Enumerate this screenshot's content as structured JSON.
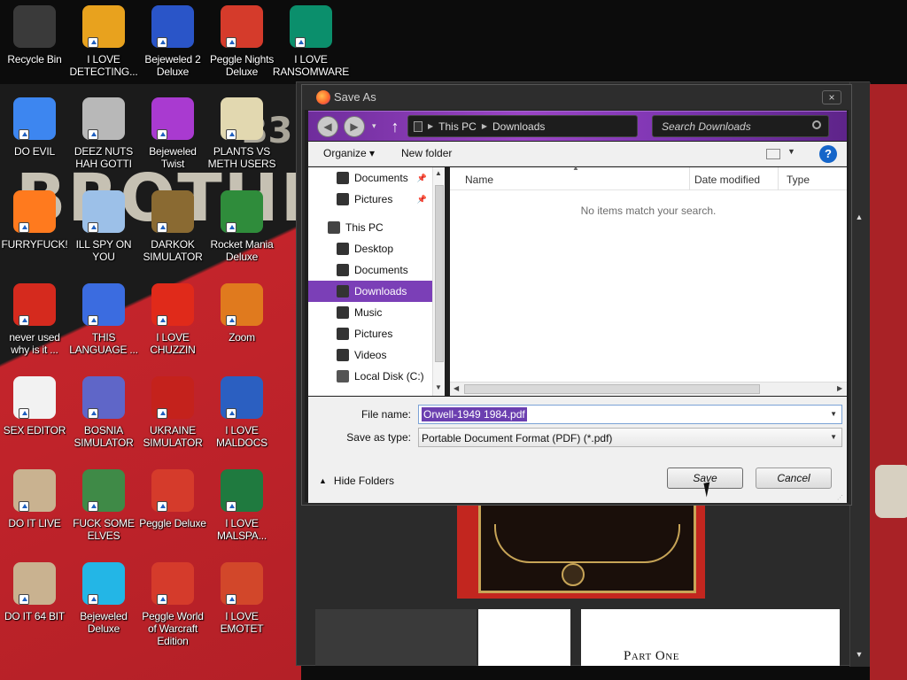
{
  "desktop": {
    "wallpaper_word": "BROTHER",
    "wallpaper_number": "B3",
    "icons": [
      {
        "label": "Recycle Bin",
        "icon": "recycle-bin-icon",
        "color": "#3a3a3a"
      },
      {
        "label": "I LOVE DETECTING...",
        "icon": "de-app-icon",
        "color": "#e8a21e"
      },
      {
        "label": "Bejeweled 2 Deluxe",
        "icon": "bejeweled-2-icon",
        "color": "#2a55c8"
      },
      {
        "label": "Peggle Nights Deluxe",
        "icon": "peggle-icon",
        "color": "#d53b2b"
      },
      {
        "label": "I LOVE RANSOMWARE",
        "icon": "publisher-icon",
        "color": "#0b8f6c"
      },
      {
        "label": "DO EVIL",
        "icon": "chrome-icon",
        "color": "#3d86f0"
      },
      {
        "label": "DEEZ NUTS HAH GOTTI",
        "icon": "windows-stack-icon",
        "color": "#b8b8b8"
      },
      {
        "label": "Bejeweled Twist",
        "icon": "bejeweled-twist-icon",
        "color": "#a93ad0"
      },
      {
        "label": "PLANTS VS METH USERS",
        "icon": "plants-icon",
        "color": "#e2d8b0"
      },
      {
        "label": "FURRYFUCK!",
        "icon": "firefox-icon",
        "color": "#ff7a1e"
      },
      {
        "label": "ILL SPY ON YOU",
        "icon": "spy-icon",
        "color": "#9cc0e8"
      },
      {
        "label": "DARKOK SIMULATOR",
        "icon": "money-bag-icon",
        "color": "#8a6a32"
      },
      {
        "label": "Rocket Mania Deluxe",
        "icon": "rocket-icon",
        "color": "#2f8c3b"
      },
      {
        "label": "never used why is it ...",
        "icon": "devcpp-icon",
        "color": "#d52a1e"
      },
      {
        "label": "THIS LANGUAGE ...",
        "icon": "goland-icon",
        "color": "#3b6ce0"
      },
      {
        "label": "I LOVE CHUZZIN",
        "icon": "chuzzle-icon",
        "color": "#e02a1a"
      },
      {
        "label": "Zoom",
        "icon": "zoom-icon",
        "color": "#e07a1e"
      },
      {
        "label": "SEX EDITOR",
        "icon": "hxd-icon",
        "color": "#f2f2f2"
      },
      {
        "label": "BOSNIA SIMULATOR",
        "icon": "spiked-ball-icon",
        "color": "#5f66c8"
      },
      {
        "label": "UKRAINE SIMULATOR",
        "icon": "radiation-icon",
        "color": "#c4221c"
      },
      {
        "label": "I LOVE MALDOCS",
        "icon": "word-icon",
        "color": "#2b5fc1"
      },
      {
        "label": "DO IT LIVE",
        "icon": "portrait-icon",
        "color": "#c9b290"
      },
      {
        "label": "FUCK SOME ELVES",
        "icon": "elf-icon",
        "color": "#3f8a47"
      },
      {
        "label": "Peggle Deluxe",
        "icon": "peggle-deluxe-icon",
        "color": "#d53b2b"
      },
      {
        "label": "I LOVE MALSPA...",
        "icon": "excel-icon",
        "color": "#1f7a3f"
      },
      {
        "label": "DO IT 64 BIT",
        "icon": "portrait-64-icon",
        "color": "#c9b290"
      },
      {
        "label": "Bejeweled Deluxe",
        "icon": "diamond-icon",
        "color": "#23b6e6"
      },
      {
        "label": "Peggle World of Warcraft Edition",
        "icon": "peggle-wow-icon",
        "color": "#d53b2b"
      },
      {
        "label": "I LOVE EMOTET",
        "icon": "powerpoint-icon",
        "color": "#d2472a"
      }
    ]
  },
  "dialog": {
    "title": "Save As",
    "close": "×",
    "path": [
      "This PC",
      "Downloads"
    ],
    "search_placeholder": "Search Downloads",
    "toolbar": {
      "organize": "Organize ▾",
      "new_folder": "New folder",
      "help": "?"
    },
    "nav_items": [
      {
        "label": "Documents",
        "pinned": true,
        "color": "#333"
      },
      {
        "label": "Pictures",
        "pinned": true,
        "color": "#333"
      },
      {
        "label": "This PC",
        "pinned": false,
        "color": "#444"
      },
      {
        "label": "Desktop",
        "pinned": false,
        "color": "#333"
      },
      {
        "label": "Documents",
        "pinned": false,
        "color": "#333"
      },
      {
        "label": "Downloads",
        "pinned": false,
        "color": "#333",
        "selected": true
      },
      {
        "label": "Music",
        "pinned": false,
        "color": "#333"
      },
      {
        "label": "Pictures",
        "pinned": false,
        "color": "#333"
      },
      {
        "label": "Videos",
        "pinned": false,
        "color": "#333"
      },
      {
        "label": "Local Disk (C:)",
        "pinned": false,
        "color": "#555"
      }
    ],
    "columns": [
      "Name",
      "Date modified",
      "Type"
    ],
    "empty_message": "No items match your search.",
    "file_name_label": "File name:",
    "file_name_value": "Orwell-1949 1984.pdf",
    "save_type_label": "Save as type:",
    "save_type_value": "Portable Document Format (PDF) (*.pdf)",
    "hide_folders": "Hide Folders",
    "save_button": "Save",
    "cancel_button": "Cancel"
  },
  "background_book": {
    "part_heading": "Part One"
  }
}
